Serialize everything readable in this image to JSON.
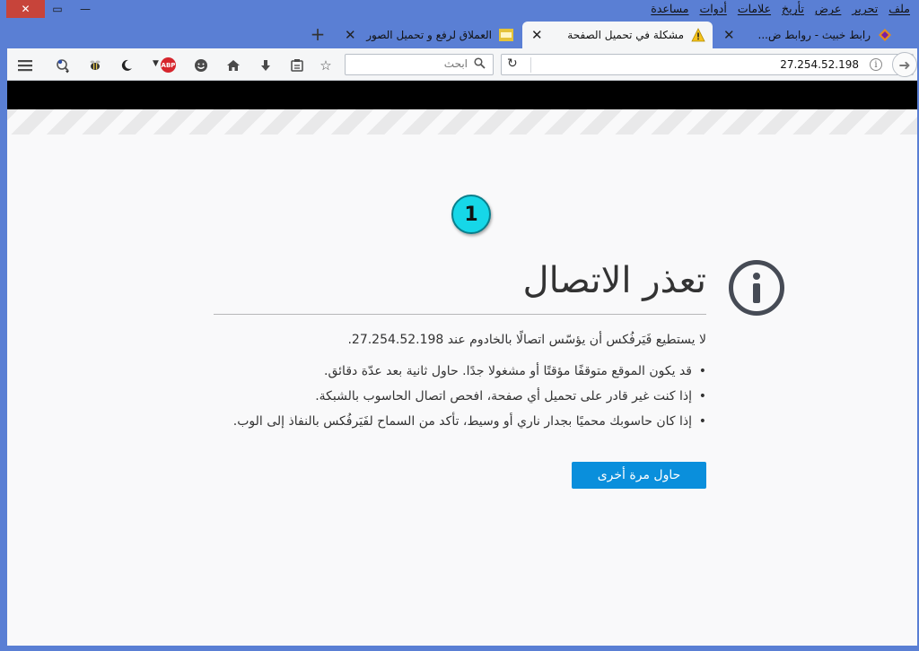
{
  "window": {
    "close_glyph": "✕",
    "maximize_glyph": "▭",
    "minimize_glyph": "—"
  },
  "menu": {
    "items": [
      "ملف",
      "تحرير",
      "عرض",
      "تأريخ",
      "علامات",
      "أدوات",
      "مساعدة"
    ]
  },
  "tabs": [
    {
      "title": "رابط خبيث - روابط ض...",
      "favicon": "site-logo-icon",
      "active": false
    },
    {
      "title": "مشكلة في تحميل الصفحة",
      "favicon": "warning-icon",
      "active": true
    },
    {
      "title": "العملاق لرفع و تحميل الصور",
      "favicon": "image-host-icon",
      "active": false
    }
  ],
  "new_tab_glyph": "+",
  "tab_close_glyph": "✕",
  "toolbar": {
    "url": "27.254.52.198",
    "search_placeholder": "ابحث",
    "icons": [
      "back-icon",
      "info-icon",
      "reload-icon",
      "search-icon",
      "star-icon",
      "reader-list-icon",
      "download-icon",
      "home-icon",
      "smiley-icon",
      "adblock-plus-icon",
      "moon-icon",
      "bee-icon",
      "extension-icon",
      "menu-icon"
    ],
    "abp_label": "ABP"
  },
  "annotation": {
    "number": "1"
  },
  "error": {
    "title": "تعذر الاتصال",
    "description": "لا يستطيع فَيَرفُكس أن يؤسّس اتصالًا بالخادوم عند 27.254.52.198.",
    "reasons": [
      "قد يكون الموقع متوقفًا مؤقتًا أو مشغولا جدًا. حاول ثانية بعد عدّة دقائق.",
      "إذا كنت غير قادر على تحميل أي صفحة، افحص اتصال الحاسوب بالشبكة.",
      "إذا كان حاسوبك محميًا بجدار ناري أو وسيط، تأكد من السماح لفَيَرفُكس بالنفاذ إلى الوب."
    ],
    "retry_label": "حاول مرة أخرى"
  },
  "colors": {
    "window_frame": "#5a7fd4",
    "close_button": "#c7443a",
    "retry_button": "#0a8fdc",
    "badge": "#16d7e8",
    "error_icon": "#464b55"
  }
}
